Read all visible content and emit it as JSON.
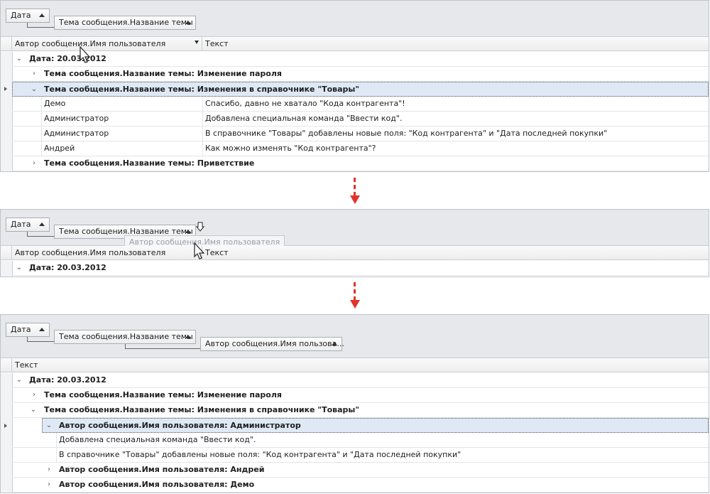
{
  "labels": {
    "date": "Дата",
    "topic": "Тема сообщения.Название темы",
    "author": "Автор сообщения.Имя пользователя",
    "author_short": "Автор сообщения.Имя пользова...",
    "text": "Текст"
  },
  "panel1": {
    "date_group": "Дата: 20.03.2012",
    "groups": [
      "Тема сообщения.Название темы: Изменение пароля",
      "Тема сообщения.Название темы: Изменения в справочнике \"Товары\"",
      "Тема сообщения.Название темы: Приветствие"
    ],
    "rows": [
      {
        "author": "Демо",
        "text": "Спасибо, давно не хватало \"Кода контрагента\"!"
      },
      {
        "author": "Администратор",
        "text": "Добавлена специальная команда \"Ввести код\"."
      },
      {
        "author": "Администратор",
        "text": "В справочнике \"Товары\" добавлены новые поля: \"Код контрагента\" и \"Дата последней покупки\""
      },
      {
        "author": "Андрей",
        "text": "Как можно изменять \"Код контрагента\"?"
      }
    ]
  },
  "panel2": {
    "date_group": "Дата: 20.03.2012",
    "drag_ghost": "Автор сообщения.Имя пользователя"
  },
  "panel3": {
    "date_group": "Дата: 20.03.2012",
    "topic_groups": [
      "Тема сообщения.Название темы: Изменение пароля",
      "Тема сообщения.Название темы: Изменения в справочнике \"Товары\""
    ],
    "author_groups": [
      "Автор сообщения.Имя пользователя: Администратор",
      "Автор сообщения.Имя пользователя: Андрей",
      "Автор сообщения.Имя пользователя: Демо"
    ],
    "rows": [
      "Добавлена специальная команда \"Ввести код\".",
      "В справочнике \"Товары\" добавлены новые поля: \"Код контрагента\" и \"Дата последней покупки\""
    ]
  },
  "colors": {
    "accent_arrow": "#e1332a",
    "selection": "#dfe9f5",
    "group_panel": "#e6e8ec"
  }
}
